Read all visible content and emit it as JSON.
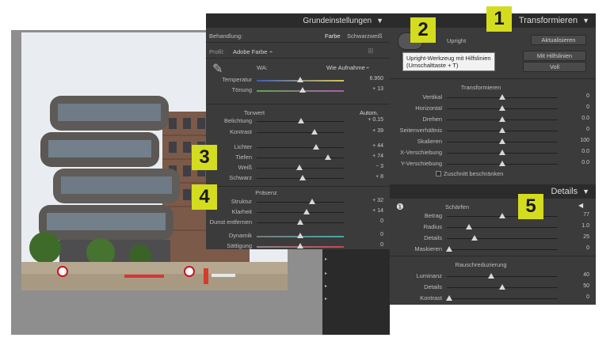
{
  "grund": {
    "title": "Grundeinstellungen",
    "behandlung_label": "Behandlung:",
    "farbe": "Farbe",
    "schwarzweiss": "Schwarzweiß",
    "profil_label": "Profil:",
    "profil_value": "Adobe Farbe",
    "profil_arrow": "÷",
    "wa_label": "WA:",
    "wa_value": "Wie Aufnahme",
    "wa_arrow": "÷",
    "tonwert": "Tonwert",
    "autom": "Autom.",
    "praesenz": "Präsenz",
    "sliders": [
      {
        "label": "Temperatur",
        "value": "6.950",
        "pos": 0.5
      },
      {
        "label": "Tönung",
        "value": "+ 13",
        "pos": 0.53
      },
      {
        "label": "Belichtung",
        "value": "+ 0.15",
        "pos": 0.51
      },
      {
        "label": "Kontrast",
        "value": "+ 39",
        "pos": 0.66
      },
      {
        "label": "Lichter",
        "value": "+ 44",
        "pos": 0.68
      },
      {
        "label": "Tiefen",
        "value": "+ 74",
        "pos": 0.82
      },
      {
        "label": "Weiß",
        "value": "− 3",
        "pos": 0.49
      },
      {
        "label": "Schwarz",
        "value": "+ 8",
        "pos": 0.53
      },
      {
        "label": "Struktur",
        "value": "+ 32",
        "pos": 0.64
      },
      {
        "label": "Klarheit",
        "value": "+ 14",
        "pos": 0.57
      },
      {
        "label": "Dunst entfernen",
        "value": "0",
        "pos": 0.5
      },
      {
        "label": "Dynamik",
        "value": "0",
        "pos": 0.5
      },
      {
        "label": "Sättigung",
        "value": "0",
        "pos": 0.5
      }
    ]
  },
  "trans": {
    "title": "Transformieren",
    "upright": "Upright",
    "aktualisieren": "Aktualisieren",
    "mit_hilfslinien": "Mit Hilfslinien",
    "voll": "Voll",
    "tooltip_line1": "Upright-Werkzeug mit Hilfslinien",
    "tooltip_line2": "(Umschalttaste + T)",
    "section": "Transformieren",
    "sliders": [
      {
        "label": "Vertikal",
        "value": "0",
        "pos": 0.5
      },
      {
        "label": "Horizontal",
        "value": "0",
        "pos": 0.5
      },
      {
        "label": "Drehen",
        "value": "0.0",
        "pos": 0.5
      },
      {
        "label": "Seitenverhältnis",
        "value": "0",
        "pos": 0.5
      },
      {
        "label": "Skalieren",
        "value": "100",
        "pos": 0.5
      },
      {
        "label": "X-Verschiebung",
        "value": "0.0",
        "pos": 0.5
      },
      {
        "label": "Y-Verschiebung",
        "value": "0.0",
        "pos": 0.5
      }
    ],
    "zuschnitt": "Zuschnitt beschränken"
  },
  "details": {
    "title": "Details",
    "schaerfen": "Schärfen",
    "rausch": "Rauschreduzierung",
    "sliders_a": [
      {
        "label": "Betrag",
        "value": "77",
        "pos": 0.5
      },
      {
        "label": "Radius",
        "value": "1.0",
        "pos": 0.2
      },
      {
        "label": "Details",
        "value": "25",
        "pos": 0.25
      },
      {
        "label": "Maskieren",
        "value": "0",
        "pos": 0.02
      }
    ],
    "sliders_b": [
      {
        "label": "Luminanz",
        "value": "40",
        "pos": 0.4
      },
      {
        "label": "Details",
        "value": "50",
        "pos": 0.5
      },
      {
        "label": "Kontrast",
        "value": "0",
        "pos": 0.02
      }
    ]
  },
  "badges": [
    "1",
    "2",
    "3",
    "4",
    "5"
  ],
  "colors": {
    "badge": "#d4dc1f",
    "panel": "#3b3b3b",
    "header": "#2b2b2b"
  }
}
